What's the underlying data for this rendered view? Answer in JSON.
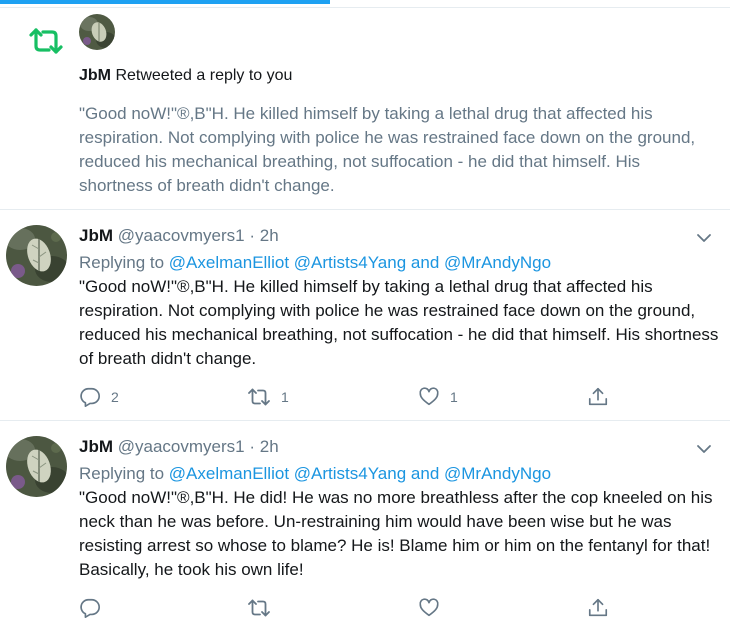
{
  "colors": {
    "accent": "#1da1f2",
    "retweet_green": "#17bf63",
    "secondary_text": "#657786",
    "mention_blue": "#1b95e0"
  },
  "notification": {
    "icon": "retweet-icon",
    "actor": "JbM",
    "action": "Retweeted a reply to you",
    "text": "\"Good noW!\"®,B\"H. He killed himself by taking a lethal drug that affected his respiration. Not complying with police he was restrained face down on the ground, reduced his mechanical breathing, not suffocation - he did that himself. His shortness of breath didn't change."
  },
  "tweets": [
    {
      "name": "JbM",
      "handle": "@yaacovmyers1",
      "separator": "·",
      "time": "2h",
      "replying_prefix": "Replying to",
      "mention1": "@AxelmanElliot",
      "mention2": "@Artists4Yang",
      "and": "and",
      "mention3": "@MrAndyNgo",
      "text": "\"Good noW!\"®,B\"H. He killed himself by taking a lethal drug that affected his respiration. Not complying with police he was restrained face down on the ground, reduced his mechanical breathing, not suffocation - he did that himself. His shortness of breath didn't change.",
      "reply_count": "2",
      "retweet_count": "1",
      "like_count": "1"
    },
    {
      "name": "JbM",
      "handle": "@yaacovmyers1",
      "separator": "·",
      "time": "2h",
      "replying_prefix": "Replying to",
      "mention1": "@AxelmanElliot",
      "mention2": "@Artists4Yang",
      "and": "and",
      "mention3": "@MrAndyNgo",
      "text": "\"Good noW!\"®,B\"H. He did! He was no more breathless after the cop kneeled on his neck than he was before. Un-restraining him would have been wise but he was resisting arrest so whose to blame? He is! Blame him or him on the fentanyl for that! Basically, he took his own life!",
      "reply_count": "",
      "retweet_count": "",
      "like_count": ""
    }
  ]
}
